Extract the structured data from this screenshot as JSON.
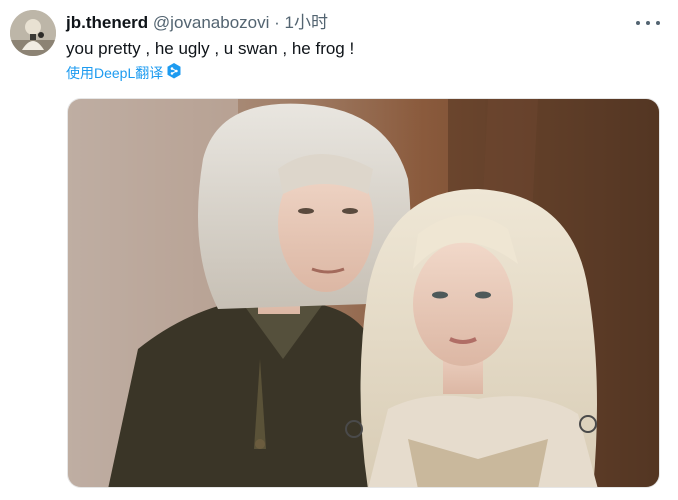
{
  "tweet": {
    "display_name": "jb.thenerd",
    "handle": "@jovanabozovi",
    "separator": "·",
    "time": "1小时",
    "text": "you pretty , he ugly , u swan , he frog !",
    "translate_label": "使用DeepL翻译"
  },
  "icons": {
    "more": "more-horizontal-icon",
    "deepl": "deepl-logo-icon"
  },
  "colors": {
    "link": "#1d9bf0",
    "secondary_text": "#536471",
    "primary_text": "#0f1419"
  }
}
